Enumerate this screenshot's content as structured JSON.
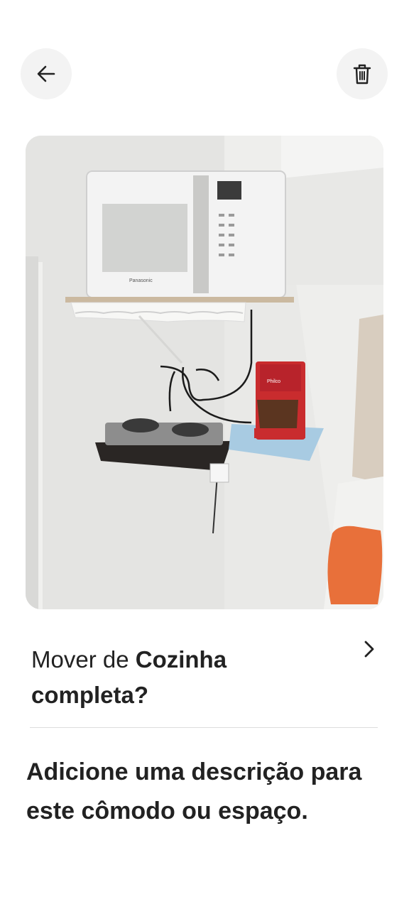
{
  "header": {
    "back_icon": "arrow-left-icon",
    "delete_icon": "trash-icon"
  },
  "photo": {
    "brand_label": "Panasonic",
    "coffee_maker_label": "Philco"
  },
  "move": {
    "prefix": "Mover de ",
    "room_name": "Cozinha completa",
    "suffix": "?",
    "chevron_icon": "chevron-right-icon"
  },
  "description": {
    "prompt": "Adicione uma descrição para este cômodo ou espaço."
  }
}
